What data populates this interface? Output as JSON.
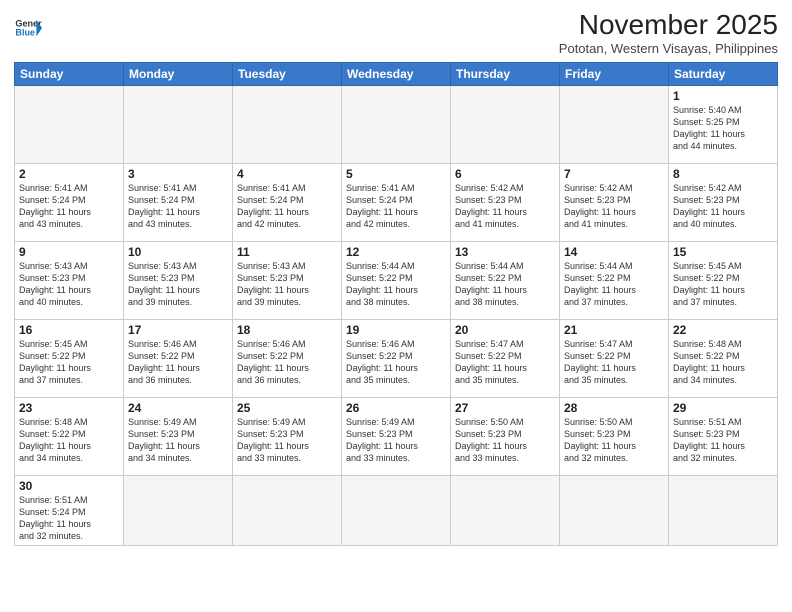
{
  "header": {
    "logo_general": "General",
    "logo_blue": "Blue",
    "month_year": "November 2025",
    "location": "Pototan, Western Visayas, Philippines"
  },
  "weekdays": [
    "Sunday",
    "Monday",
    "Tuesday",
    "Wednesday",
    "Thursday",
    "Friday",
    "Saturday"
  ],
  "weeks": [
    [
      {
        "day": "",
        "info": ""
      },
      {
        "day": "",
        "info": ""
      },
      {
        "day": "",
        "info": ""
      },
      {
        "day": "",
        "info": ""
      },
      {
        "day": "",
        "info": ""
      },
      {
        "day": "",
        "info": ""
      },
      {
        "day": "1",
        "info": "Sunrise: 5:40 AM\nSunset: 5:25 PM\nDaylight: 11 hours\nand 44 minutes."
      }
    ],
    [
      {
        "day": "2",
        "info": "Sunrise: 5:41 AM\nSunset: 5:24 PM\nDaylight: 11 hours\nand 43 minutes."
      },
      {
        "day": "3",
        "info": "Sunrise: 5:41 AM\nSunset: 5:24 PM\nDaylight: 11 hours\nand 43 minutes."
      },
      {
        "day": "4",
        "info": "Sunrise: 5:41 AM\nSunset: 5:24 PM\nDaylight: 11 hours\nand 42 minutes."
      },
      {
        "day": "5",
        "info": "Sunrise: 5:41 AM\nSunset: 5:24 PM\nDaylight: 11 hours\nand 42 minutes."
      },
      {
        "day": "6",
        "info": "Sunrise: 5:42 AM\nSunset: 5:23 PM\nDaylight: 11 hours\nand 41 minutes."
      },
      {
        "day": "7",
        "info": "Sunrise: 5:42 AM\nSunset: 5:23 PM\nDaylight: 11 hours\nand 41 minutes."
      },
      {
        "day": "8",
        "info": "Sunrise: 5:42 AM\nSunset: 5:23 PM\nDaylight: 11 hours\nand 40 minutes."
      }
    ],
    [
      {
        "day": "9",
        "info": "Sunrise: 5:43 AM\nSunset: 5:23 PM\nDaylight: 11 hours\nand 40 minutes."
      },
      {
        "day": "10",
        "info": "Sunrise: 5:43 AM\nSunset: 5:23 PM\nDaylight: 11 hours\nand 39 minutes."
      },
      {
        "day": "11",
        "info": "Sunrise: 5:43 AM\nSunset: 5:23 PM\nDaylight: 11 hours\nand 39 minutes."
      },
      {
        "day": "12",
        "info": "Sunrise: 5:44 AM\nSunset: 5:22 PM\nDaylight: 11 hours\nand 38 minutes."
      },
      {
        "day": "13",
        "info": "Sunrise: 5:44 AM\nSunset: 5:22 PM\nDaylight: 11 hours\nand 38 minutes."
      },
      {
        "day": "14",
        "info": "Sunrise: 5:44 AM\nSunset: 5:22 PM\nDaylight: 11 hours\nand 37 minutes."
      },
      {
        "day": "15",
        "info": "Sunrise: 5:45 AM\nSunset: 5:22 PM\nDaylight: 11 hours\nand 37 minutes."
      }
    ],
    [
      {
        "day": "16",
        "info": "Sunrise: 5:45 AM\nSunset: 5:22 PM\nDaylight: 11 hours\nand 37 minutes."
      },
      {
        "day": "17",
        "info": "Sunrise: 5:46 AM\nSunset: 5:22 PM\nDaylight: 11 hours\nand 36 minutes."
      },
      {
        "day": "18",
        "info": "Sunrise: 5:46 AM\nSunset: 5:22 PM\nDaylight: 11 hours\nand 36 minutes."
      },
      {
        "day": "19",
        "info": "Sunrise: 5:46 AM\nSunset: 5:22 PM\nDaylight: 11 hours\nand 35 minutes."
      },
      {
        "day": "20",
        "info": "Sunrise: 5:47 AM\nSunset: 5:22 PM\nDaylight: 11 hours\nand 35 minutes."
      },
      {
        "day": "21",
        "info": "Sunrise: 5:47 AM\nSunset: 5:22 PM\nDaylight: 11 hours\nand 35 minutes."
      },
      {
        "day": "22",
        "info": "Sunrise: 5:48 AM\nSunset: 5:22 PM\nDaylight: 11 hours\nand 34 minutes."
      }
    ],
    [
      {
        "day": "23",
        "info": "Sunrise: 5:48 AM\nSunset: 5:22 PM\nDaylight: 11 hours\nand 34 minutes."
      },
      {
        "day": "24",
        "info": "Sunrise: 5:49 AM\nSunset: 5:23 PM\nDaylight: 11 hours\nand 34 minutes."
      },
      {
        "day": "25",
        "info": "Sunrise: 5:49 AM\nSunset: 5:23 PM\nDaylight: 11 hours\nand 33 minutes."
      },
      {
        "day": "26",
        "info": "Sunrise: 5:49 AM\nSunset: 5:23 PM\nDaylight: 11 hours\nand 33 minutes."
      },
      {
        "day": "27",
        "info": "Sunrise: 5:50 AM\nSunset: 5:23 PM\nDaylight: 11 hours\nand 33 minutes."
      },
      {
        "day": "28",
        "info": "Sunrise: 5:50 AM\nSunset: 5:23 PM\nDaylight: 11 hours\nand 32 minutes."
      },
      {
        "day": "29",
        "info": "Sunrise: 5:51 AM\nSunset: 5:23 PM\nDaylight: 11 hours\nand 32 minutes."
      }
    ],
    [
      {
        "day": "30",
        "info": "Sunrise: 5:51 AM\nSunset: 5:24 PM\nDaylight: 11 hours\nand 32 minutes."
      },
      {
        "day": "",
        "info": ""
      },
      {
        "day": "",
        "info": ""
      },
      {
        "day": "",
        "info": ""
      },
      {
        "day": "",
        "info": ""
      },
      {
        "day": "",
        "info": ""
      },
      {
        "day": "",
        "info": ""
      }
    ]
  ]
}
